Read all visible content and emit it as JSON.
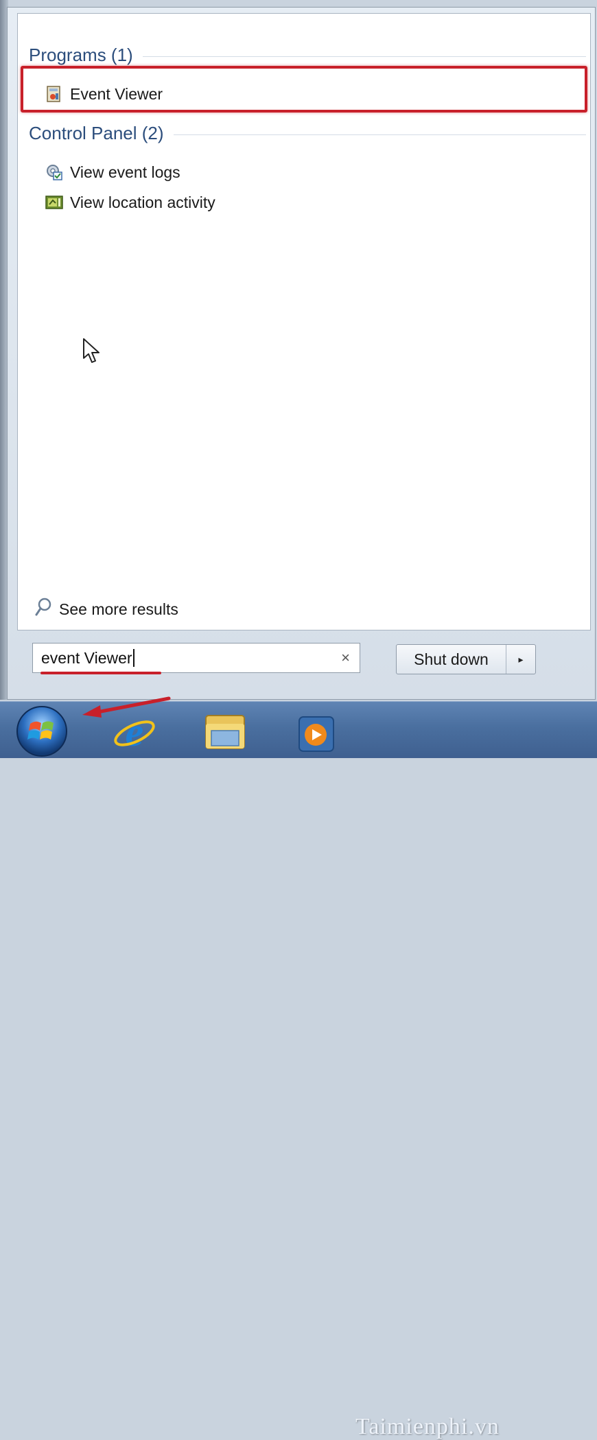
{
  "search_results": {
    "programs": {
      "header": "Programs (1)",
      "items": [
        {
          "label": "Event Viewer",
          "icon": "event-viewer-icon"
        }
      ]
    },
    "control_panel": {
      "header": "Control Panel (2)",
      "items": [
        {
          "label": "View event logs",
          "icon": "event-logs-icon"
        },
        {
          "label": "View location activity",
          "icon": "location-activity-icon"
        }
      ]
    },
    "see_more": "See more results"
  },
  "search": {
    "value": "event Viewer",
    "clear_glyph": "×"
  },
  "power": {
    "shutdown_label": "Shut down",
    "arrow_glyph": "▸"
  },
  "taskbar": {
    "items": [
      "start-orb-icon",
      "internet-explorer-icon",
      "windows-explorer-icon",
      "media-player-icon"
    ],
    "watermark": "Taimienphi.vn"
  },
  "colors": {
    "highlight": "#c8202a",
    "group_header": "#2b4d7c"
  }
}
